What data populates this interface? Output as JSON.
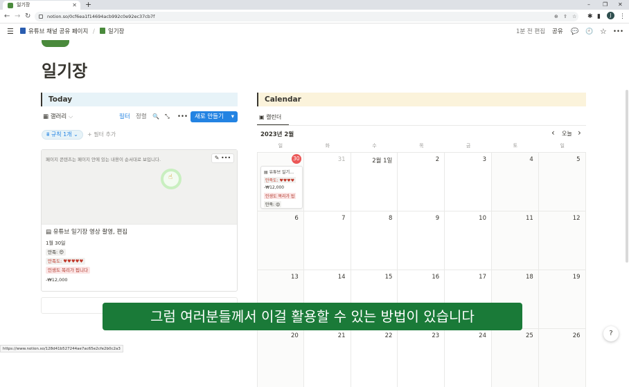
{
  "browser": {
    "tab_title": "일기장",
    "tab_close": "✕",
    "new_tab": "+",
    "url": "notion.so/0cf6ea1f14694acb992c0e92ec37cb7f",
    "avatar_letter": "J",
    "window_minimize": "–",
    "window_maximize": "❐",
    "window_close": "✕",
    "back": "←",
    "forward": "→",
    "reload": "↻"
  },
  "notion_topbar": {
    "menu_icon": "☰",
    "breadcrumb_1": "유튜브 채널 공유 페이지",
    "separator": "/",
    "breadcrumb_2": "일기장",
    "edited": "1분 전 편집",
    "share": "공유",
    "comment_icon": "💬",
    "history_icon": "🕘",
    "star_icon": "☆",
    "more_icon": "•••"
  },
  "page": {
    "title": "일기장"
  },
  "today": {
    "header": "Today",
    "view_name": "갤러리",
    "view_caret": "⌵",
    "filter": "필터",
    "sort": "정렬",
    "search_icon": "🔍",
    "expand_icon": "⤡",
    "more": "•••",
    "new_button": "새로 만들기",
    "new_caret": "▾",
    "rule_chip": "규칙 1개",
    "rule_chip_caret": "⌄",
    "add_filter": "+ 필터 추가",
    "card": {
      "preview_text": "페이지 콘텐츠는 페이지 안에 있는 내용이 순서대로 보입니다.",
      "edit_icon": "✎",
      "more_icon": "•••",
      "title": "유튜브 일기장 영상 촬영, 편집",
      "date": "1월 30일",
      "satisfaction": "만족: 😍",
      "rating": "만족도: ♥♥♥♥♥",
      "tag": "인생도 복리가 됩니다",
      "amount": "-₩12,000"
    }
  },
  "calendar": {
    "header": "Calendar",
    "view_name": "캘린더",
    "month": "2023년 2월",
    "prev": "‹",
    "today_btn": "오늘",
    "next": "›",
    "weekdays": [
      "일",
      "화",
      "수",
      "목",
      "금",
      "토",
      "일"
    ],
    "weeks": [
      [
        "30",
        "31",
        "2월 1일",
        "2",
        "3",
        "4",
        "5"
      ],
      [
        "6",
        "7",
        "8",
        "9",
        "10",
        "11",
        "12"
      ],
      [
        "13",
        "14",
        "15",
        "16",
        "17",
        "18",
        "19"
      ],
      [
        "20",
        "21",
        "22",
        "23",
        "24",
        "25",
        "26"
      ]
    ],
    "event": {
      "title": "유튜브 일기…",
      "rating": "만족도: ♥♥♥♥",
      "amount": "-₩12,000",
      "tag": "인생도 복리가 됩",
      "satisfaction": "만족: 😍"
    }
  },
  "subtitle": "그럼 여러분들께서 이걸 활용할 수 있는 방법이 있습니다",
  "status_url": "https://www.notion.so/128d41b527244ae7ac65e2cfe2b0c2a3",
  "help": "?",
  "colors": {
    "accent": "#2383e2",
    "today_red": "#eb5757",
    "subtitle_bg": "#1a7a38",
    "today_header_bg": "#e7f3f8",
    "calendar_header_bg": "#fbf3db"
  }
}
